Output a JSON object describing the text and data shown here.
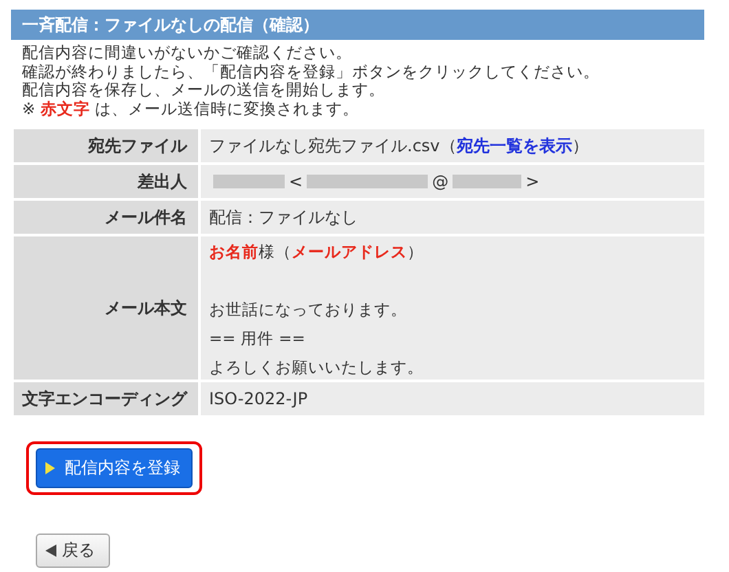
{
  "title": "一斉配信：ファイルなしの配信（確認）",
  "notes": [
    [
      {
        "text": "配信内容に間違いがないかご確認ください。",
        "red": false
      }
    ],
    [
      {
        "text": "確認が終わりましたら、「配信内容を登録」ボタンをクリックしてください。",
        "red": false
      }
    ],
    [
      {
        "text": "配信内容を保存し、メールの送信を開始します。",
        "red": false
      }
    ],
    [
      {
        "text": "※ ",
        "red": false
      },
      {
        "text": "赤文字",
        "red": true
      },
      {
        "text": " は、メール送信時に変換されます。",
        "red": false
      }
    ]
  ],
  "rows": [
    {
      "kind": "file",
      "label": "宛先ファイル",
      "value": "ファイルなし宛先ファイル.csv（",
      "link": "宛先一覧を表示",
      "after": "）"
    },
    {
      "kind": "sender",
      "label": "差出人",
      "open": "<",
      "at": "@",
      "close": ">"
    },
    {
      "kind": "text",
      "label": "メール件名",
      "value": "配信：ファイルなし"
    },
    {
      "kind": "body",
      "label": "メール本文",
      "paragraphs": [
        [
          [
            {
              "text": "お名前",
              "red": true
            },
            {
              "text": "様（",
              "red": false
            },
            {
              "text": "メールアドレス",
              "red": true
            },
            {
              "text": "）",
              "red": false
            }
          ]
        ],
        [
          [
            {
              "text": "お世話になっております。",
              "red": false
            }
          ],
          [
            {
              "text": "== 用件 ==",
              "red": false
            }
          ],
          [
            {
              "text": "よろしくお願いいたします。",
              "red": false
            }
          ]
        ]
      ]
    },
    {
      "kind": "text",
      "label": "文字エンコーディング",
      "value": "ISO-2022-JP"
    }
  ],
  "submit": "配信内容を登録",
  "back": "戻る"
}
